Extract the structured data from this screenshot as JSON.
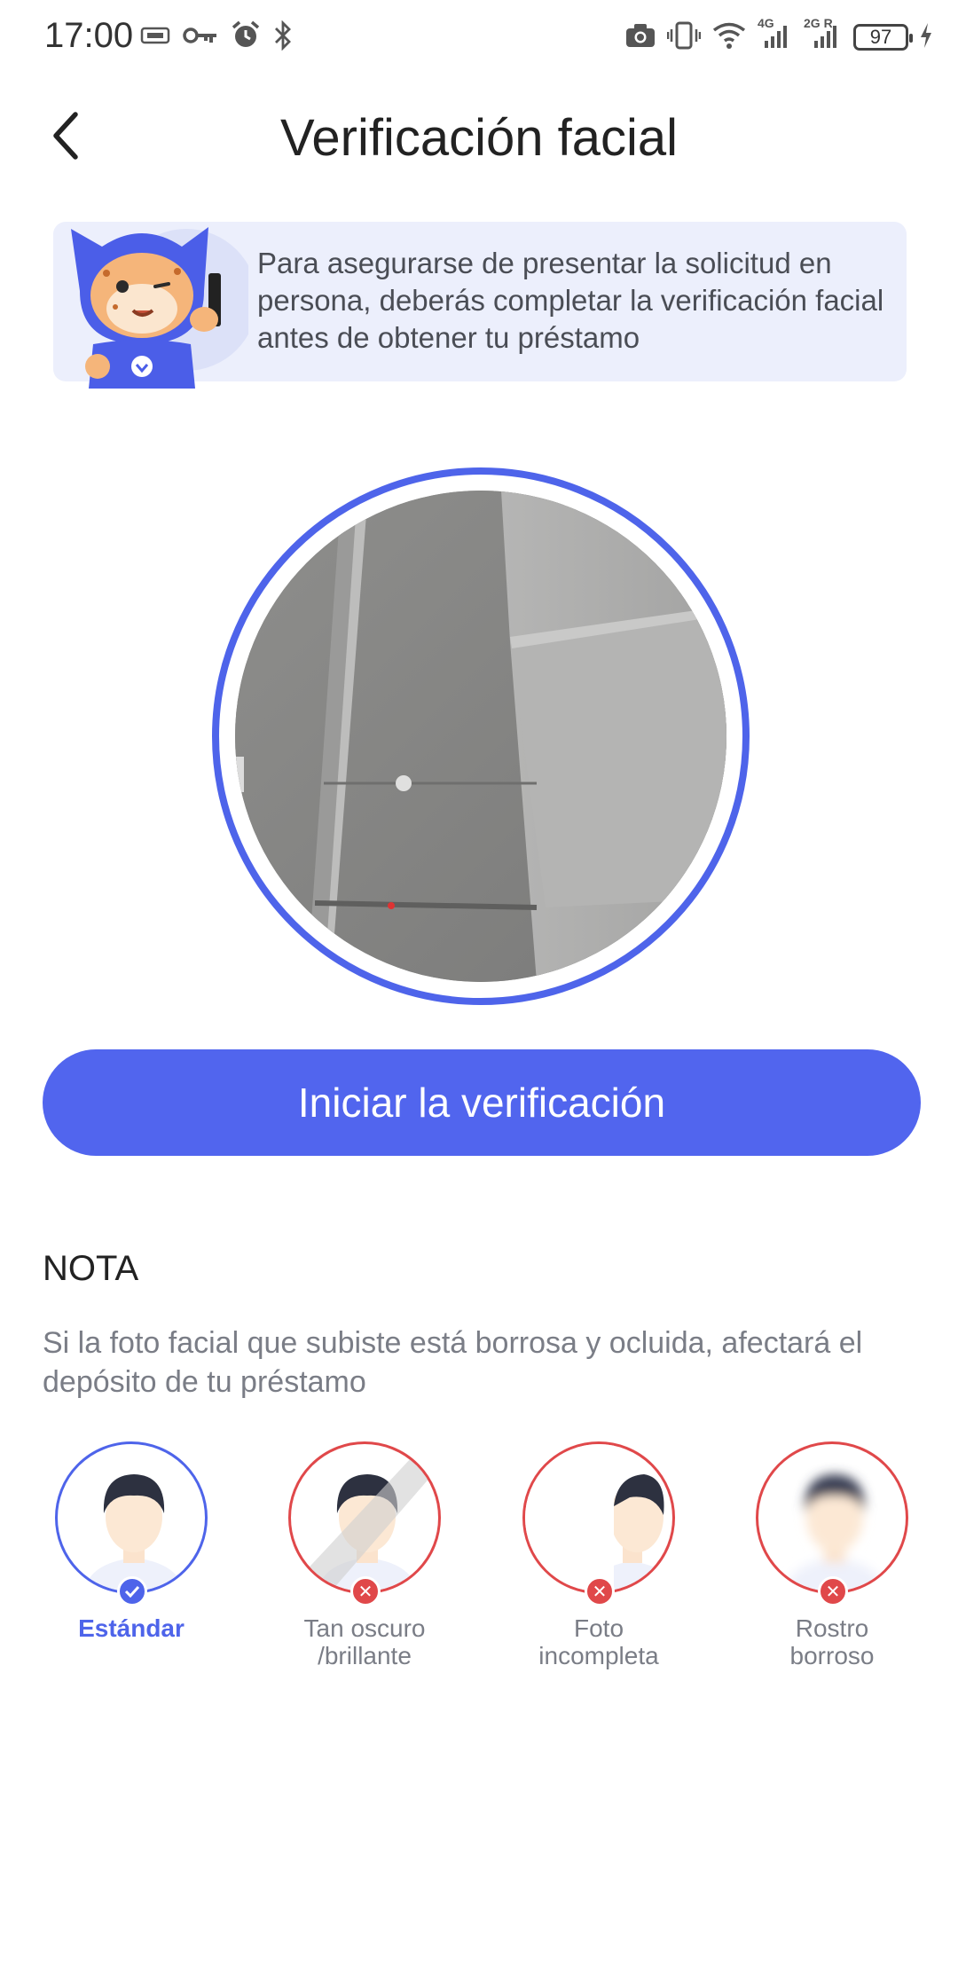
{
  "status_bar": {
    "time": "17:00",
    "battery": "97",
    "network_1": "4G",
    "network_2": "2G R"
  },
  "header": {
    "title": "Verificación facial"
  },
  "banner": {
    "text": "Para asegurarse de presentar la solicitud en persona, deberás completar la verificación facial antes de obtener tu préstamo"
  },
  "actions": {
    "start_label": "Iniciar la verificación"
  },
  "note": {
    "title": "NOTA",
    "text": "Si la foto facial que subiste está borrosa y ocluida, afectará el depósito de tu préstamo"
  },
  "examples": [
    {
      "label": "Estándar",
      "status": "ok"
    },
    {
      "label": "Tan oscuro\n/brillante",
      "status": "bad"
    },
    {
      "label": "Foto\nincompleta",
      "status": "bad"
    },
    {
      "label": "Rostro\nborroso",
      "status": "bad"
    }
  ],
  "colors": {
    "accent": "#5165ee",
    "error": "#e0484a",
    "banner_bg": "#eceffc"
  }
}
